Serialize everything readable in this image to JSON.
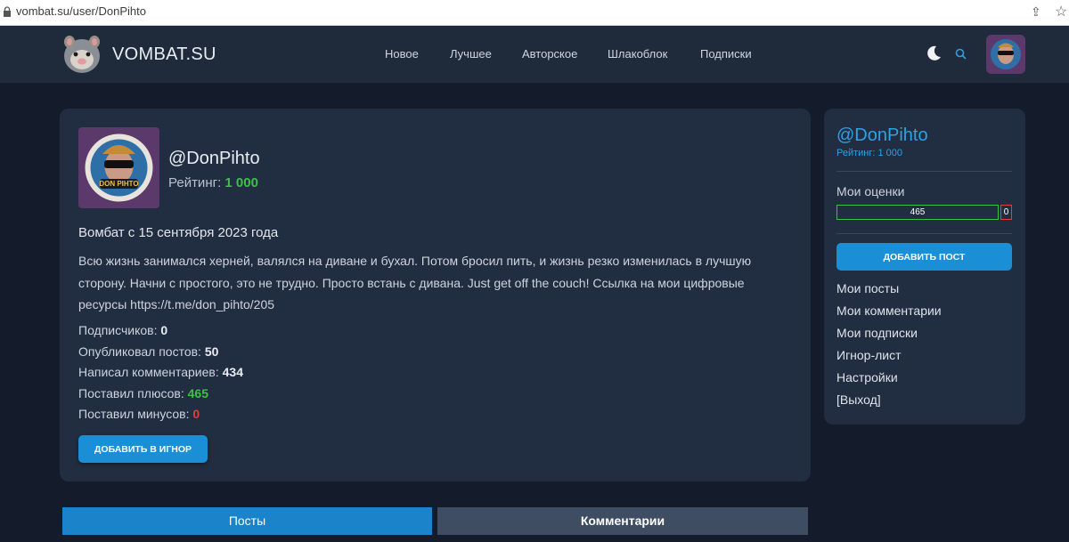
{
  "browser": {
    "url": "vombat.su/user/DonPihto"
  },
  "header": {
    "logo_text": "VOMBAT.SU",
    "nav": [
      "Новое",
      "Лучшее",
      "Авторское",
      "Шлакоблок",
      "Подписки"
    ]
  },
  "profile": {
    "username": "@DonPihto",
    "rating_label": "Рейтинг: ",
    "rating_value": "1 000",
    "since": "Вомбат с 15 сентября 2023 года",
    "bio": "Всю жизнь занимался херней, валялся на диване и бухал. Потом бросил пить, и жизнь резко изменилась в лучшую сторону. Начни с простого, это не трудно. Просто встань с дивана. Just get off the couch! Ссылка на мои цифровые ресурсы https://t.me/don_pihto/205",
    "stats": {
      "subscribers_label": "Подписчиков: ",
      "subscribers": "0",
      "posts_label": "Опубликовал постов: ",
      "posts": "50",
      "comments_label": "Написал комментариев: ",
      "comments": "434",
      "plus_label": "Поставил плюсов: ",
      "plus": "465",
      "minus_label": "Поставил минусов: ",
      "minus": "0"
    },
    "ignore_button": "ДОБАВИТЬ В ИГНОР"
  },
  "tabs": {
    "posts": "Посты",
    "comments": "Комментарии"
  },
  "sidebar": {
    "username": "@DonPihto",
    "rating": "Рейтинг: 1 000",
    "votes_label": "Мои оценки",
    "votes_plus": "465",
    "votes_minus": "0",
    "add_post": "ДОБАВИТЬ ПОСТ",
    "links": [
      "Мои посты",
      "Мои комментарии",
      "Мои подписки",
      "Игнор-лист",
      "Настройки",
      "[Выход]"
    ]
  },
  "colors": {
    "accent": "#1a8fd6",
    "positive": "#3fbf4a",
    "negative": "#e0403a",
    "link": "#2aa3e8"
  }
}
